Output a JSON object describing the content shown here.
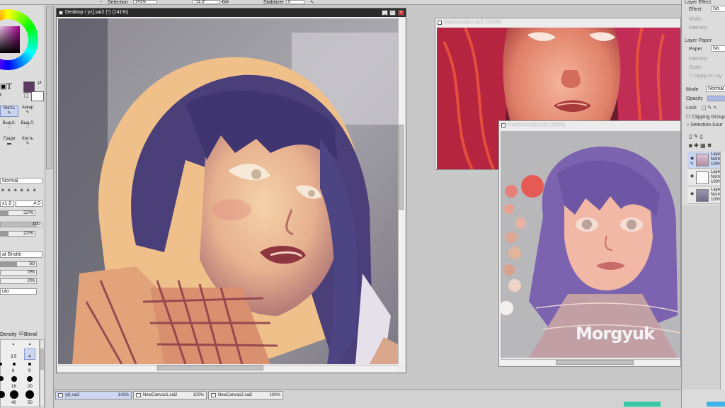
{
  "toolbar": {
    "selection_label": "Selection",
    "zoom": "141%",
    "rotation": "-11.3°",
    "stabilizer_label": "Stabilizer",
    "stabilizer_value": "5"
  },
  "left_panel": {
    "tools": [
      {
        "label": "Кисть"
      },
      {
        "label": "Аквар"
      },
      {
        "label": "Выд.К."
      },
      {
        "label": "Выд.Л."
      },
      {
        "label": "Гради"
      },
      {
        "label": "Кисть"
      }
    ],
    "text_tool_glyph": "T",
    "blend_mode": "Normal",
    "size_multiplier": "x1.0",
    "size_value": "4.0",
    "min_size": "22%",
    "density_value": "100",
    "min_density": "22%",
    "texture": "at Bristle",
    "texture_strength": "50",
    "param_a": "0%",
    "param_b": "0%",
    "mode": "uto",
    "density_label": "Density",
    "blend_label": "Blend",
    "brush_sizes_row1": [
      "3.5",
      "4"
    ],
    "brush_sizes_row2": [
      "8",
      "9"
    ],
    "brush_sizes_row3": [
      "16",
      "20"
    ],
    "brush_sizes_row4": [
      "40",
      "50"
    ]
  },
  "main_window": {
    "title": "Desktop / yz[.sai2 (*) (141%)"
  },
  "window_new1": {
    "title": "NewCanvas1.sai2 (100%)"
  },
  "window_new2": {
    "title": "NewCanvas2.sai2 (100%)",
    "signature": "Morgyuk"
  },
  "right_panel": {
    "layer_effect": "Layer Effect",
    "effect_label": "Effect",
    "effect_value": "No",
    "width_label": "Width",
    "intensity_label": "Intensity",
    "layer_paper": "Layer Paper",
    "paper_label": "Paper",
    "paper_value": "No",
    "intensity2_label": "Intensity",
    "scale_label": "Scale",
    "apply_label": "Apply to Lay",
    "mode_label": "Mode",
    "mode_value": "Normal",
    "opacity_label": "Opacity",
    "lock_label": "Lock",
    "clipping_label": "Clipping Group",
    "selection_source_label": "Selection Sour",
    "layers": [
      {
        "name": "Layer",
        "mode": "Norma",
        "opacity": "100%"
      },
      {
        "name": "Layer",
        "mode": "Norma",
        "opacity": "100%"
      },
      {
        "name": "Layer",
        "mode": "Norma",
        "opacity": "100%"
      }
    ]
  },
  "tabs": [
    {
      "label": "yz[.sai2",
      "zoom": "141%"
    },
    {
      "label": "NewCanvas1.sai2",
      "zoom": "100%"
    },
    {
      "label": "NewCanvas2.sai2",
      "zoom": "100%"
    }
  ],
  "colors": {
    "primary": "#5a3a5e",
    "accent_tab": "#cdd7f3",
    "title_active": "#2a2a2a"
  }
}
